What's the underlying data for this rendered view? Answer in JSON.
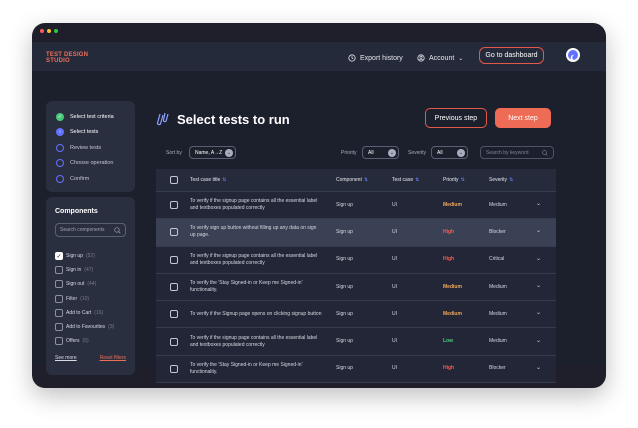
{
  "window": {
    "dot_colors": [
      "#ff5f57",
      "#ffbd2e",
      "#28c840"
    ]
  },
  "brand": {
    "line1": "TEST DESIGN",
    "line2": "STUDIO"
  },
  "topbar": {
    "export_label": "Export history",
    "account_label": "Account",
    "dashboard_label": "Go to dashboard"
  },
  "steps": [
    {
      "label": "Select test criteria",
      "state": "done"
    },
    {
      "label": "Select tests",
      "state": "active"
    },
    {
      "label": "Review tests",
      "state": "todo"
    },
    {
      "label": "Choose operation",
      "state": "todo"
    },
    {
      "label": "Confirm",
      "state": "todo"
    }
  ],
  "components": {
    "heading": "Components",
    "search_placeholder": "Search components",
    "items": [
      {
        "label": "Sign up",
        "count": "(52)",
        "checked": true
      },
      {
        "label": "Sign in",
        "count": "(47)",
        "checked": false
      },
      {
        "label": "Sign out",
        "count": "(44)",
        "checked": false
      },
      {
        "label": "Filter",
        "count": "(10)",
        "checked": false
      },
      {
        "label": "Add to Cart",
        "count": "(16)",
        "checked": false
      },
      {
        "label": "Add to Favourites",
        "count": "(3)",
        "checked": false
      },
      {
        "label": "Offers",
        "count": "(5)",
        "checked": false
      }
    ],
    "see_more": "See more",
    "reset": "Reset filters"
  },
  "page": {
    "title": "Select tests to run",
    "prev_label": "Previous step",
    "next_label": "Next step"
  },
  "filters": {
    "sort_label": "Sort by",
    "sort_value": "Name, A→Z",
    "priority_label": "Priority",
    "priority_value": "All",
    "severity_label": "Severity",
    "severity_value": "All",
    "keyword_placeholder": "Search by keyword"
  },
  "table": {
    "headers": [
      "Test case title",
      "Component",
      "Test case",
      "Priority",
      "Severity"
    ],
    "rows": [
      {
        "title": "To verify if the signup page contains all the essential label and textboxes populated correctly",
        "component": "Sign up",
        "test_case": "UI",
        "priority": "Medium",
        "severity": "Medium",
        "highlight": false
      },
      {
        "title": "To verify sign up button without filling up any data on sign up page.",
        "component": "Sign up",
        "test_case": "UI",
        "priority": "High",
        "severity": "Blocker",
        "highlight": true
      },
      {
        "title": "To verify if the signup page contains all the essential label and textboxes populated correctly",
        "component": "Sign up",
        "test_case": "UI",
        "priority": "High",
        "severity": "Critical",
        "highlight": false
      },
      {
        "title": "To verify the 'Stay Signed-in or Keep me Signed-in' functionality.",
        "component": "Sign up",
        "test_case": "UI",
        "priority": "Medium",
        "severity": "Medium",
        "highlight": false
      },
      {
        "title": "To verify if the Signup page opens on clicking signup button",
        "component": "Sign up",
        "test_case": "UI",
        "priority": "Medium",
        "severity": "Medium",
        "highlight": false
      },
      {
        "title": "To verify if the signup page contains all the essential label and textboxes populated correctly",
        "component": "Sign up",
        "test_case": "UI",
        "priority": "Low",
        "severity": "Medium",
        "highlight": false
      },
      {
        "title": "To verify the 'Stay Signed-in or Keep me Signed-in' functionality.",
        "component": "Sign up",
        "test_case": "UI",
        "priority": "High",
        "severity": "Blocker",
        "highlight": false
      }
    ]
  },
  "priority_colors": {
    "High": "#ff5a4e",
    "Medium": "#f4a95b",
    "Low": "#4ccf7c"
  },
  "icons": {
    "export": "history-icon",
    "account": "user-circle-icon",
    "theme": "moon-icon",
    "title": "test-tubes-icon",
    "search": "search-icon",
    "sort": "sort-arrows-icon",
    "expand": "chevron-down-icon"
  }
}
